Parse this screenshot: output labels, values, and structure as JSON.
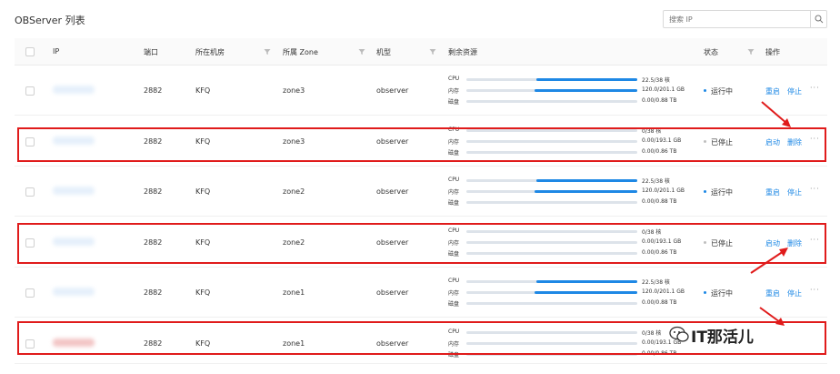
{
  "page": {
    "title": "OBServer 列表",
    "search_placeholder": "搜索 IP"
  },
  "table": {
    "columns": {
      "ip": "IP",
      "port": "端口",
      "idc": "所在机房",
      "zone": "所属 Zone",
      "type": "机型",
      "resources": "剩余资源",
      "status": "状态",
      "actions": "操作"
    },
    "res_labels": {
      "cpu": "CPU",
      "mem": "内存",
      "disk": "磁盘"
    },
    "rows": [
      {
        "port": "2882",
        "idc": "KFQ",
        "zone": "zone3",
        "type": "observer",
        "cpu": "22.5/38 核",
        "mem": "120.0/201.1 GB",
        "disk": "0.00/0.88 TB",
        "cpu_frac": 0.59,
        "mem_frac": 0.6,
        "disk_frac": 0,
        "status": "运行中",
        "status_color": "#1e88e5",
        "action1": "重启",
        "action2": "停止",
        "more": "···"
      },
      {
        "port": "2882",
        "idc": "KFQ",
        "zone": "zone3",
        "type": "observer",
        "cpu": "0/38 核",
        "mem": "0.00/193.1 GB",
        "disk": "0.00/0.86 TB",
        "cpu_frac": 0,
        "mem_frac": 0,
        "disk_frac": 0,
        "status": "已停止",
        "status_color": "#bfbfbf",
        "action1": "启动",
        "action2": "删除",
        "more": "···"
      },
      {
        "port": "2882",
        "idc": "KFQ",
        "zone": "zone2",
        "type": "observer",
        "cpu": "22.5/38 核",
        "mem": "120.0/201.1 GB",
        "disk": "0.00/0.88 TB",
        "cpu_frac": 0.59,
        "mem_frac": 0.6,
        "disk_frac": 0,
        "status": "运行中",
        "status_color": "#1e88e5",
        "action1": "重启",
        "action2": "停止",
        "more": "···"
      },
      {
        "port": "2882",
        "idc": "KFQ",
        "zone": "zone2",
        "type": "observer",
        "cpu": "0/38 核",
        "mem": "0.00/193.1 GB",
        "disk": "0.00/0.86 TB",
        "cpu_frac": 0,
        "mem_frac": 0,
        "disk_frac": 0,
        "status": "已停止",
        "status_color": "#bfbfbf",
        "action1": "启动",
        "action2": "删除",
        "more": "···"
      },
      {
        "port": "2882",
        "idc": "KFQ",
        "zone": "zone1",
        "type": "observer",
        "cpu": "22.5/38 核",
        "mem": "120.0/201.1 GB",
        "disk": "0.00/0.88 TB",
        "cpu_frac": 0.59,
        "mem_frac": 0.6,
        "disk_frac": 0,
        "status": "运行中",
        "status_color": "#1e88e5",
        "action1": "重启",
        "action2": "停止",
        "more": "···"
      },
      {
        "port": "2882",
        "idc": "KFQ",
        "zone": "zone1",
        "type": "observer",
        "cpu": "0/38 核",
        "mem": "0.00/193.1 GB",
        "disk": "0.00/0.86 TB",
        "cpu_frac": 0,
        "mem_frac": 0,
        "disk_frac": 0,
        "status": "",
        "status_color": "#bfbfbf",
        "action1": "",
        "action2": "",
        "more": ""
      }
    ]
  },
  "watermark": {
    "text": "IT那活儿"
  },
  "colors": {
    "highlight": "#e01b1b",
    "accent": "#1e88e5"
  }
}
